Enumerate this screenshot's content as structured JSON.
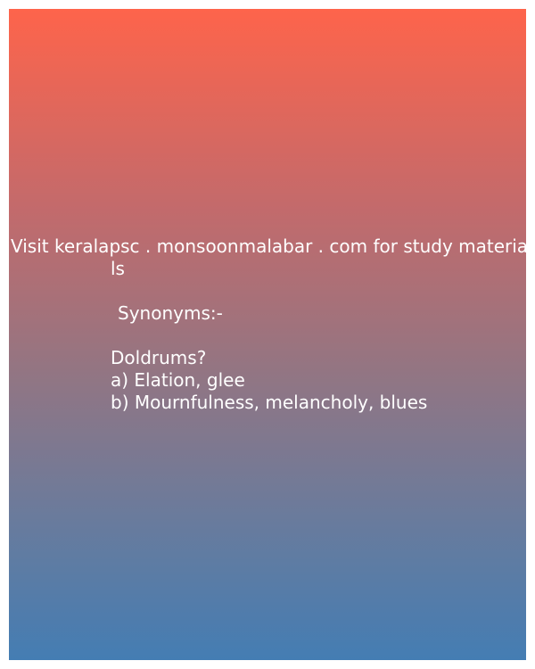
{
  "promo": {
    "line1": "Visit keralapsc . monsoonmalabar . com for study materia",
    "line2": "ls"
  },
  "quiz": {
    "heading": "Synonyms:-",
    "question": "Doldrums?",
    "options": [
      "a) Elation, glee",
      "b) Mournfulness, melancholy, blues"
    ]
  },
  "colors": {
    "gradient_top": "#fe644b",
    "gradient_bottom": "#447db3",
    "text": "#ffffff"
  }
}
